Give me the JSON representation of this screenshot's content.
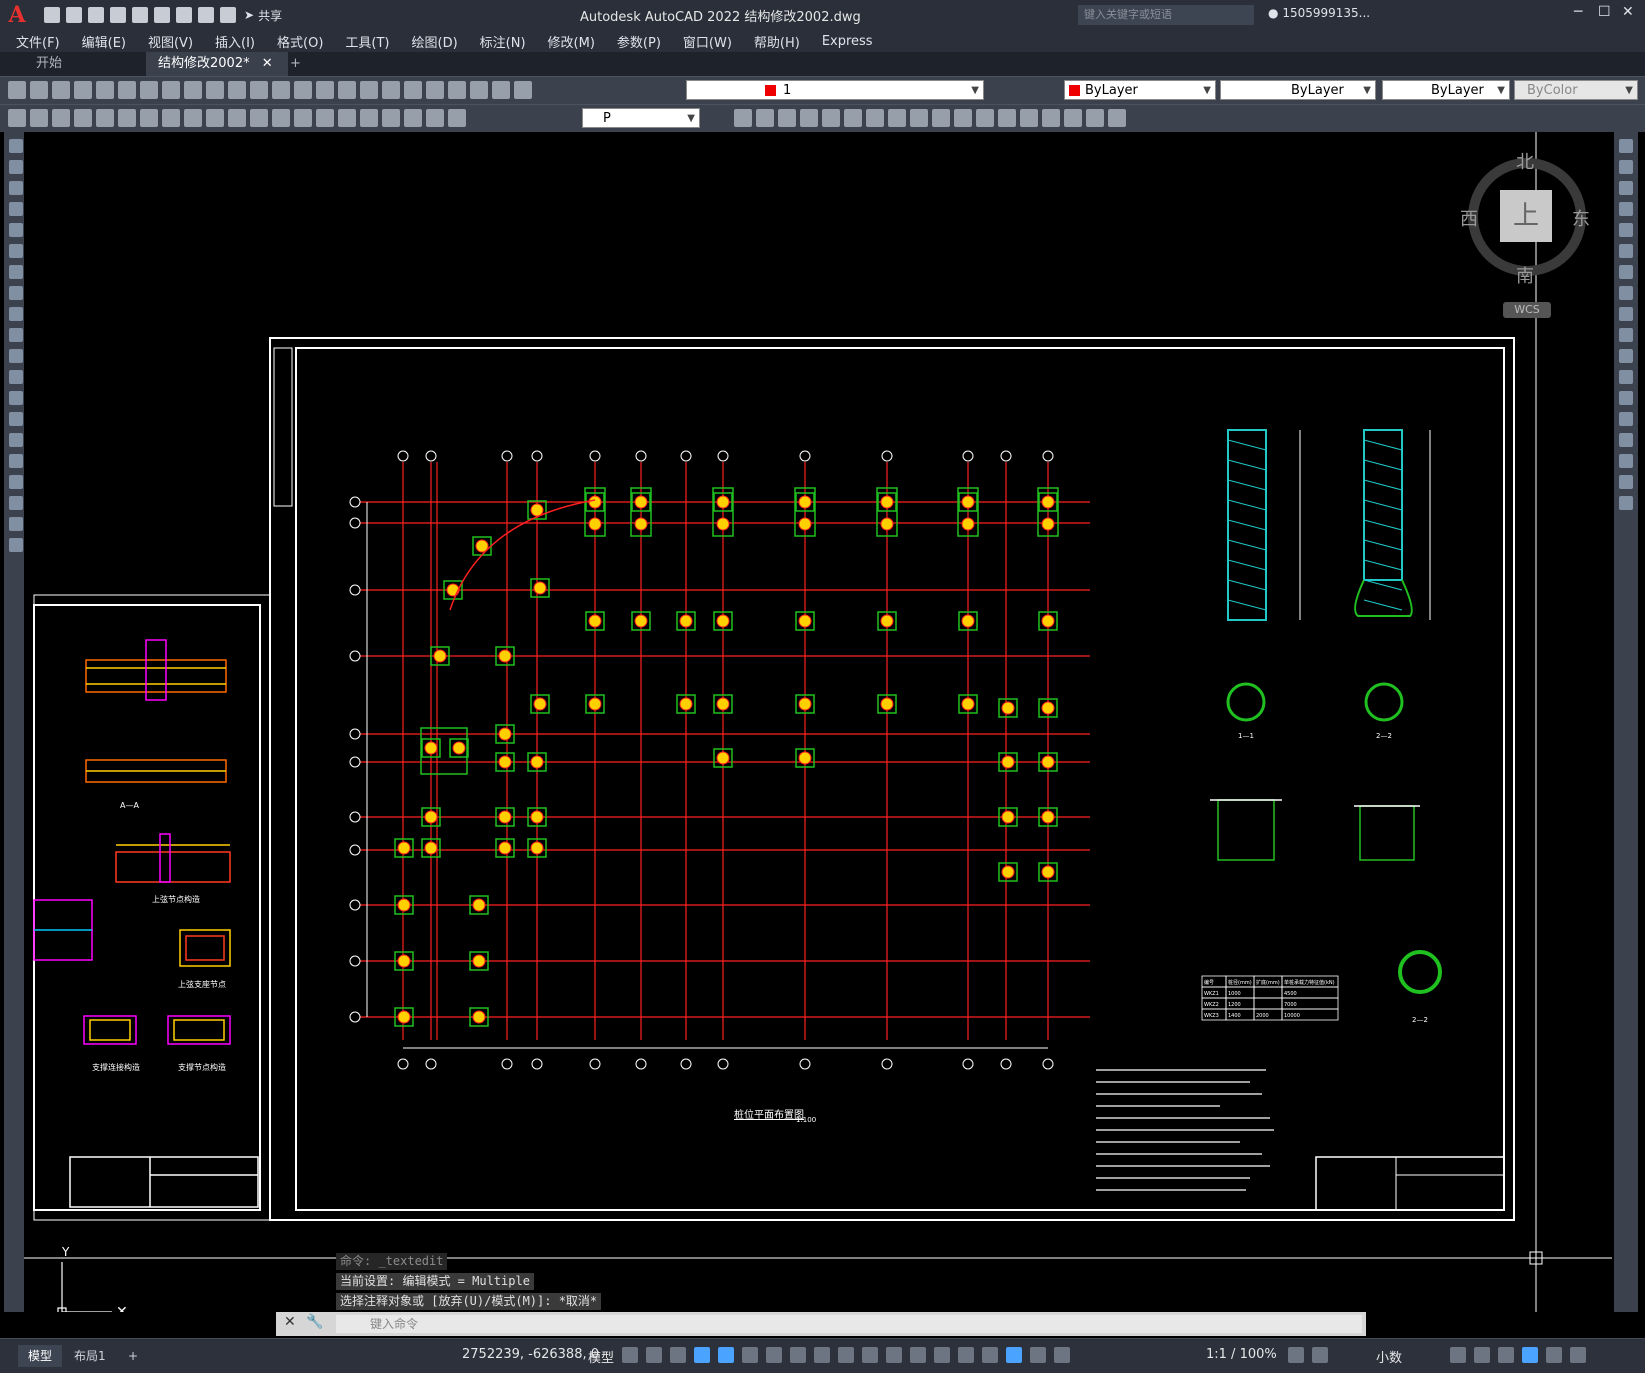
{
  "app": {
    "logo": "A",
    "title": "Autodesk AutoCAD 2022    结构修改2002.dwg",
    "share_label": "共享",
    "search_placeholder": "键入关键字或短语",
    "user": "1505999135..."
  },
  "menu": [
    "文件(F)",
    "编辑(E)",
    "视图(V)",
    "插入(I)",
    "格式(O)",
    "工具(T)",
    "绘图(D)",
    "标注(N)",
    "修改(M)",
    "参数(P)",
    "窗口(W)",
    "帮助(H)",
    "Express"
  ],
  "tabs": {
    "start": "开始",
    "doc": "结构修改2002*",
    "close": "✕",
    "add": "+"
  },
  "toolbar": {
    "layer_value": "1",
    "color_value": "ByLayer",
    "linetype_value": "ByLayer",
    "lineweight_value": "ByLayer",
    "plotstyle_value": "ByColor",
    "textstyle_value": "P"
  },
  "viewcube": {
    "north": "北",
    "south": "南",
    "east": "东",
    "west": "西",
    "top": "上",
    "wcs": "WCS"
  },
  "drawing": {
    "plan_title": "桩位平面布置图",
    "plan_scale": "1:100",
    "left_captions": [
      "A—A",
      "上弦节点构造",
      "上弦支座节点",
      "支撑连接构造",
      "支撑节点构造"
    ],
    "right_captions": [
      "1—1",
      "2—2",
      "2—2"
    ],
    "table_rows": [
      [
        "编号",
        "桩径(mm)",
        "扩底(mm)",
        "单桩承载力特征值(kN)"
      ],
      [
        "WKZ1",
        "1000",
        "",
        "4500"
      ],
      [
        "WKZ2",
        "1200",
        "",
        "7000"
      ],
      [
        "WKZ3",
        "1400",
        "2000",
        "10000"
      ]
    ],
    "grid_top": [
      "①",
      "②③",
      "⑤",
      "⑥",
      "⑦",
      "⑧",
      "⑨",
      "⑩",
      "⑪",
      "⑫",
      "⑬",
      "⑭",
      "⑮"
    ],
    "grid_left": [
      "P",
      "N",
      "M",
      "K",
      "H",
      "G",
      "F",
      "E",
      "C",
      "B",
      "A"
    ]
  },
  "command": {
    "history": [
      "命令: _textedit",
      "当前设置: 编辑模式 = Multiple",
      "选择注释对象或 [放弃(U)/模式(M)]: *取消*"
    ],
    "input_placeholder": "键入命令"
  },
  "status": {
    "model_tab": "模型",
    "layout_tab": "布局1",
    "coords": "2752239, -626388, 0",
    "model_space": "模型",
    "scale": "1:1 / 100%",
    "units": "小数"
  },
  "colors": {
    "grid_line": "#ff2020",
    "pile_fill": "#ffd000",
    "pile_box": "#20c020",
    "frame": "#ffffff",
    "hatch": "#20c8c8"
  }
}
